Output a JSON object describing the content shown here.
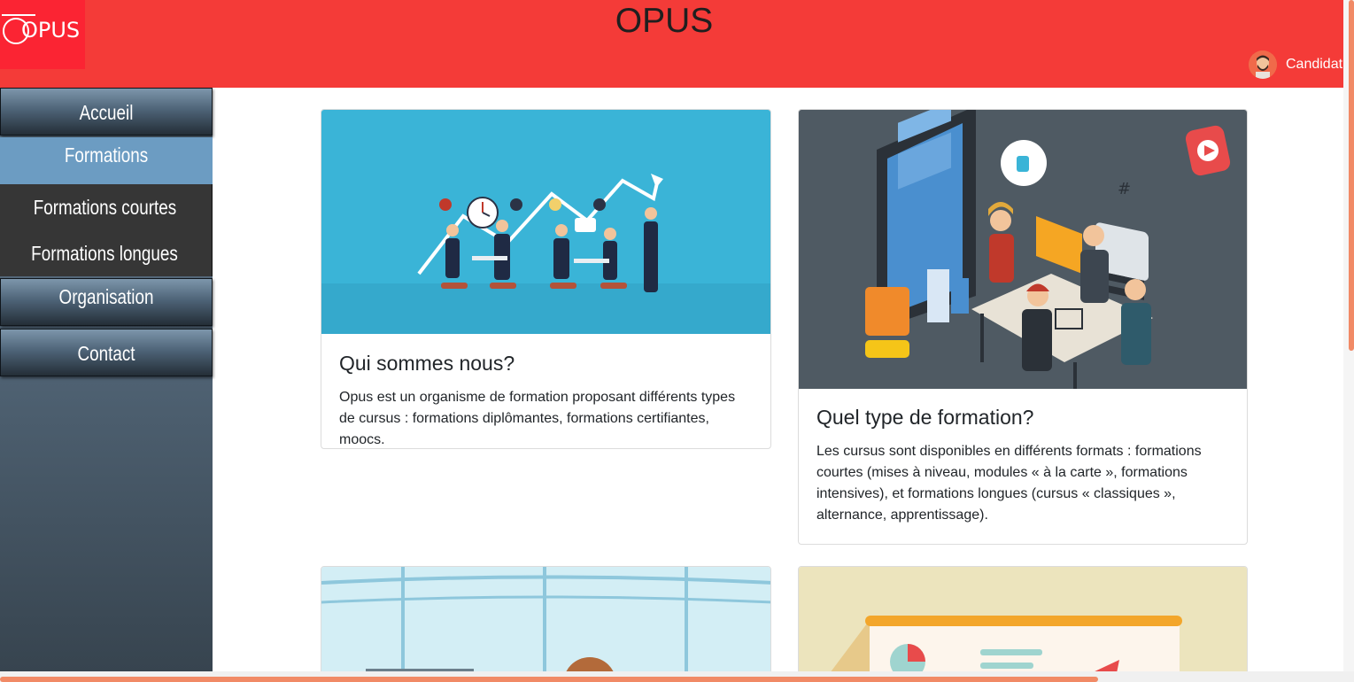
{
  "header": {
    "logo_text": "OPUS",
    "site_title": "OPUS",
    "user_label": "Candidat"
  },
  "sidebar": {
    "items": [
      {
        "label": "Accueil"
      },
      {
        "label": "Formations"
      },
      {
        "label": "Organisation"
      },
      {
        "label": "Contact"
      }
    ],
    "submenu": [
      {
        "label": "Formations courtes"
      },
      {
        "label": "Formations longues"
      }
    ]
  },
  "cards": [
    {
      "title": "Qui sommes nous?",
      "text": "Opus est un organisme de formation proposant différents types de cursus : formations diplômantes, formations certifiantes, moocs."
    },
    {
      "title": "Quel type de formation?",
      "text": "Les cursus sont disponibles en différents formats : formations courtes (mises à niveau, modules « à la carte », formations intensives), et formations longues (cursus « classiques », alternance, apprentissage)."
    }
  ],
  "colors": {
    "header_bg": "#f43b38",
    "logo_bg": "#fb2433",
    "sidebar_active": "#6c9cc2",
    "submenu_bg": "#363636",
    "scroll_thumb": "#f18a66"
  },
  "icons": [
    "user-avatar-icon",
    "thumbs-up-icon",
    "play-icon",
    "hash-icon"
  ]
}
